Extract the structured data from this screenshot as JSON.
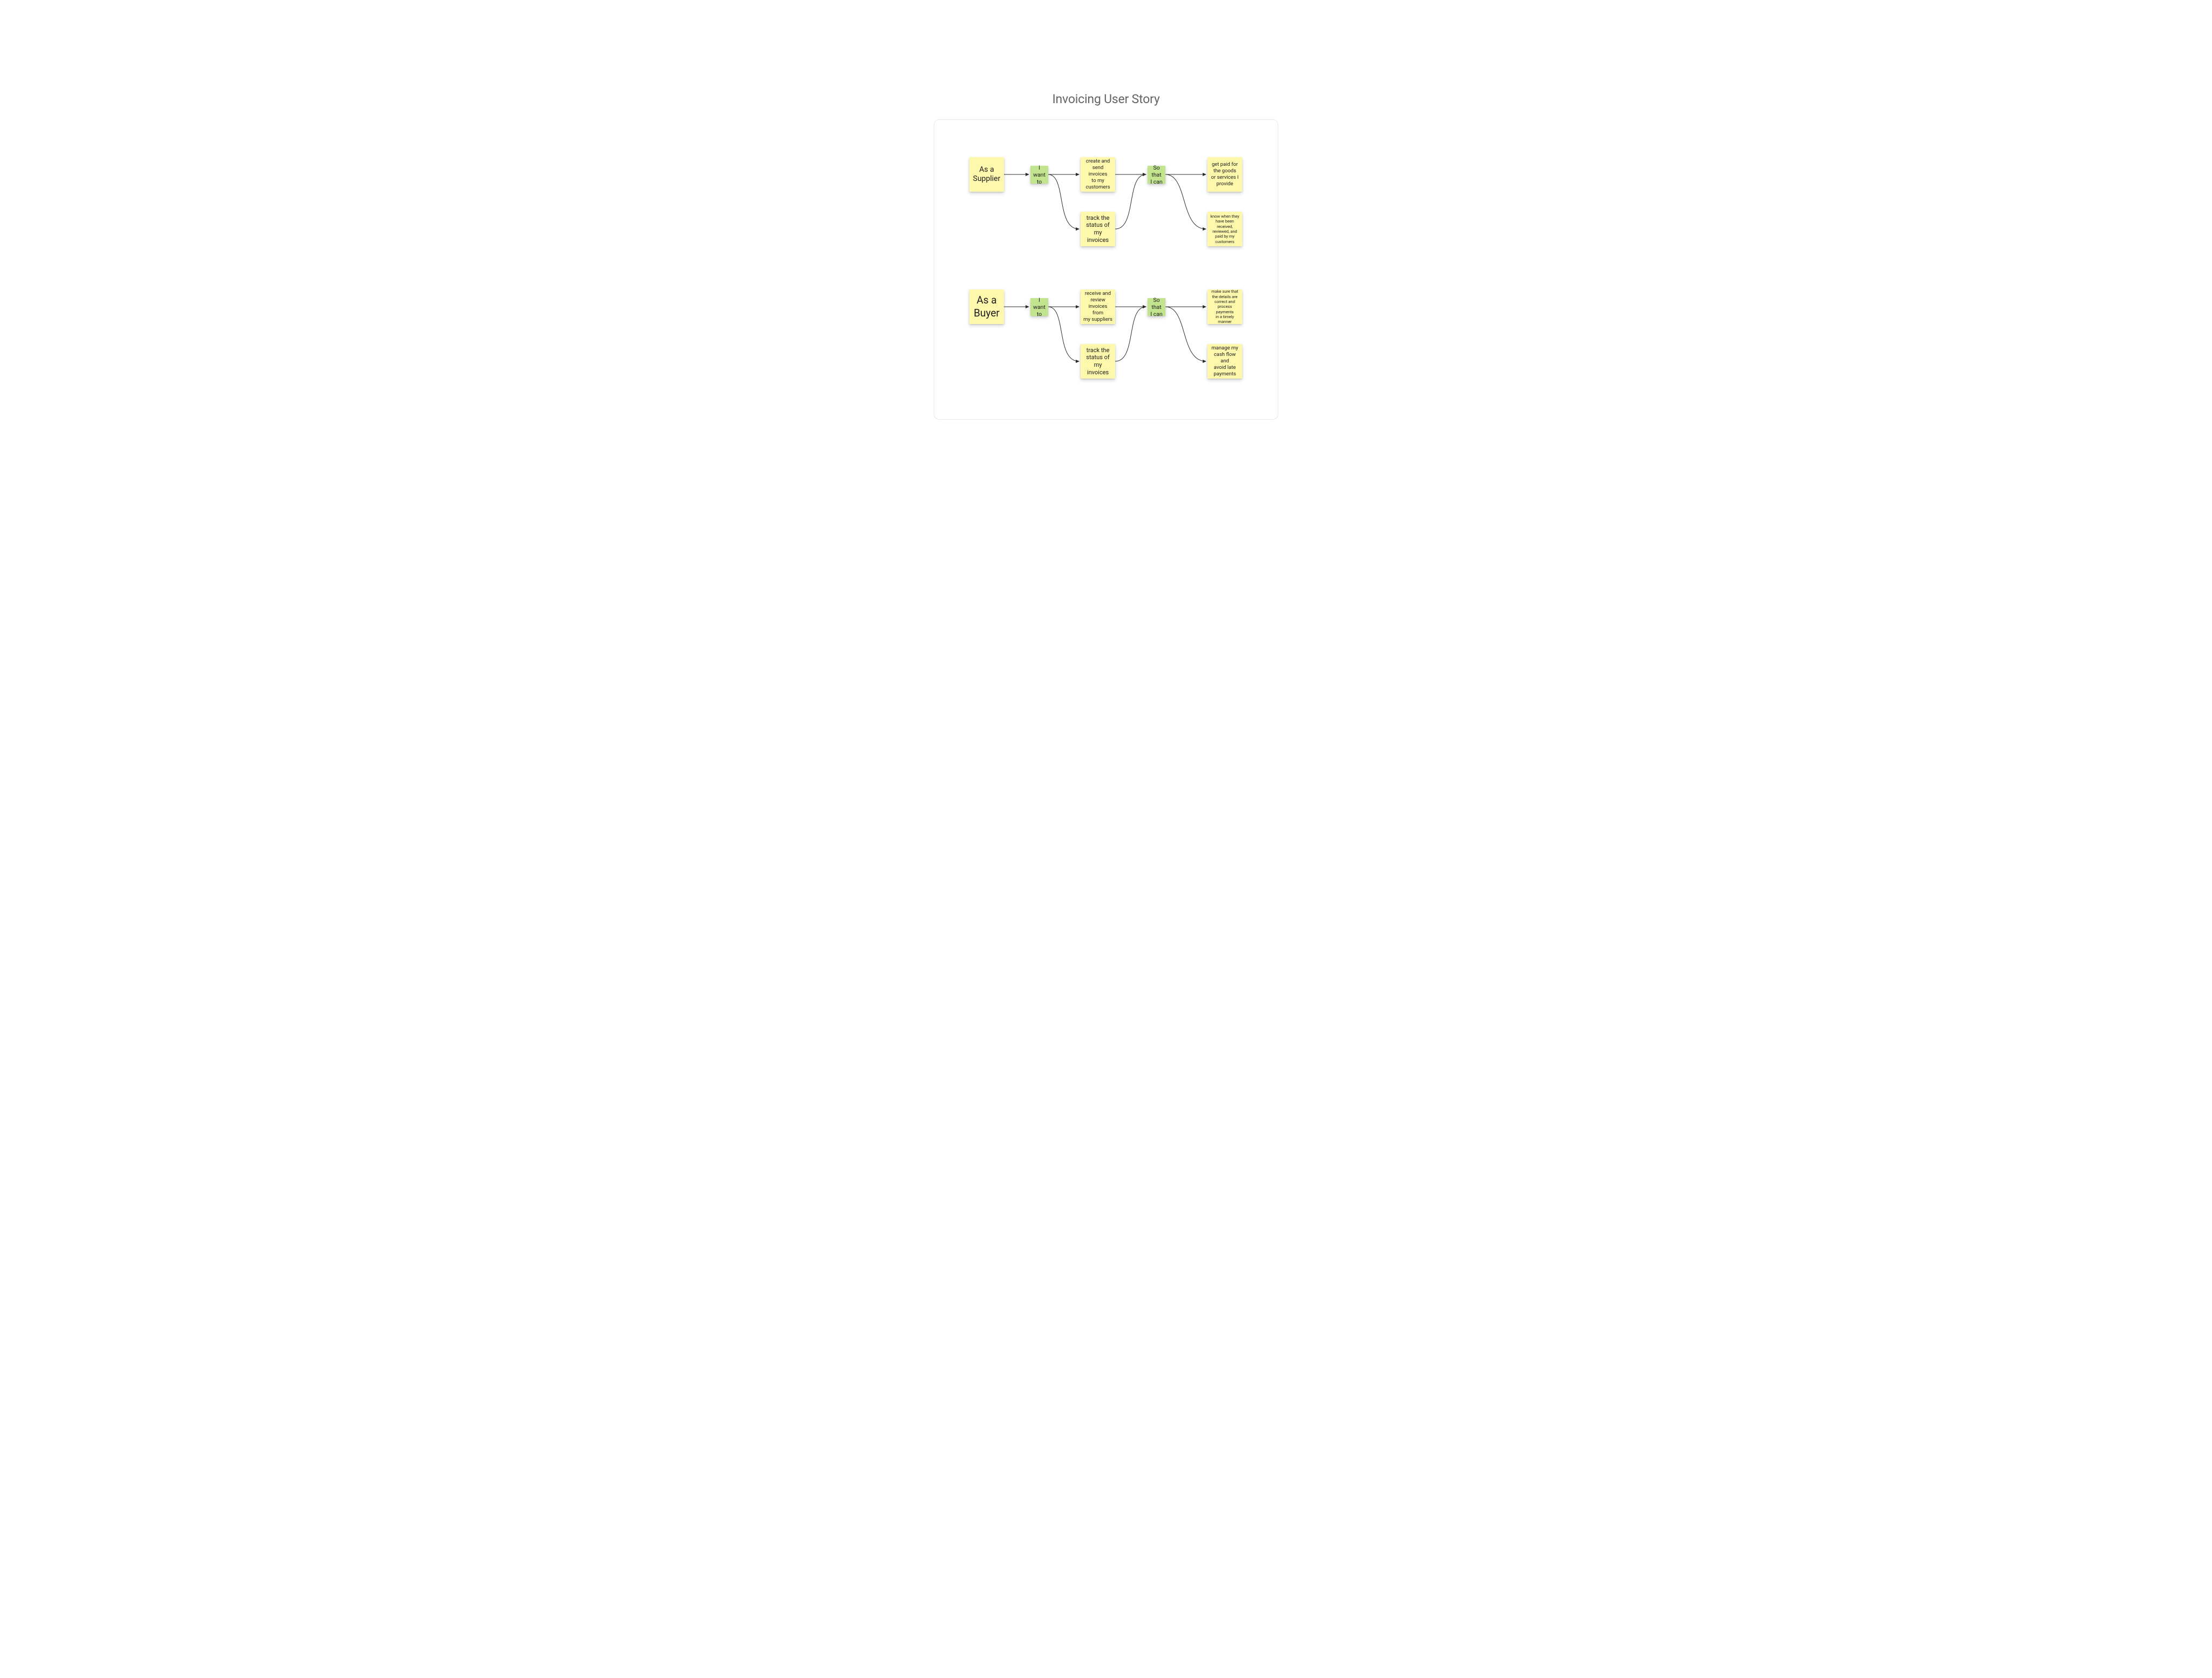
{
  "title": "Invoicing User Story",
  "supplier": {
    "persona": "As a\nSupplier",
    "want": "I want\nto",
    "goal1": "create and\nsend invoices\nto my\ncustomers",
    "goal2": "track the\nstatus of\nmy invoices",
    "sothat": "So that\nI can",
    "benefit1": "get paid for\nthe goods\nor services I\nprovide",
    "benefit2": "know when they\nhave been\nreceived,\nreviewed, and\npaid by my\ncustomers"
  },
  "buyer": {
    "persona": "As a\nBuyer",
    "want": "I want\nto",
    "goal1": "receive and\nreview\ninvoices from\nmy suppliers",
    "goal2": "track the\nstatus of\nmy invoices",
    "sothat": "So that\nI can",
    "benefit1": "make sure that\nthe details are\ncorrect and\nprocess payments\nin a timely\nmanner",
    "benefit2": "manage my\ncash flow and\navoid late\npayments"
  }
}
